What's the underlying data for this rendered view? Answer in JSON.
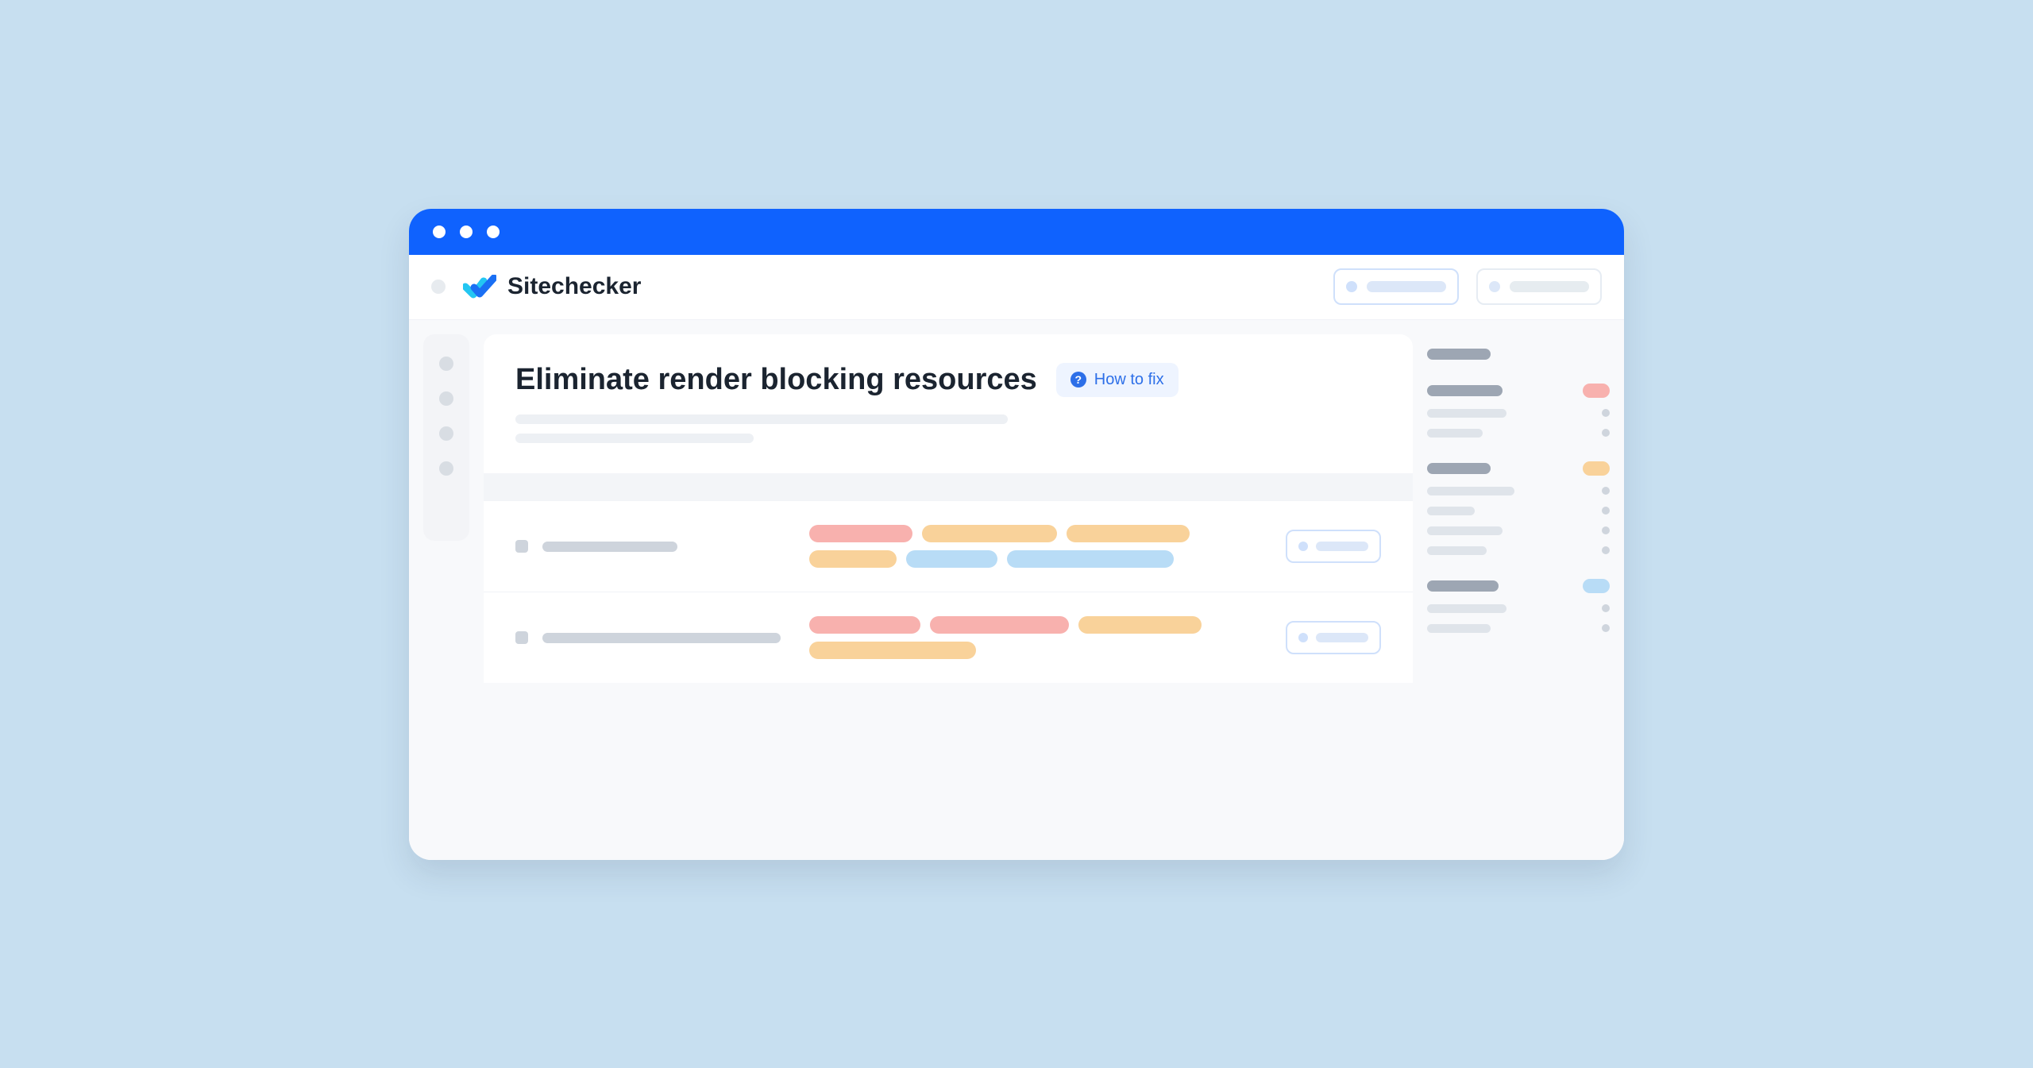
{
  "app": {
    "name": "Sitechecker"
  },
  "card": {
    "title": "Eliminate render blocking resources",
    "howToFix": "How to fix"
  },
  "colors": {
    "accent": "#0f62fe",
    "link": "#2d6fe8",
    "red": "#f8b1ae",
    "orange": "#f9d29a",
    "blue": "#b8dcf6"
  }
}
